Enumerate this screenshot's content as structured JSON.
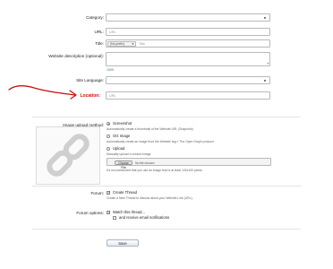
{
  "form": {
    "category": {
      "label": "Category:",
      "value": ""
    },
    "url": {
      "label": "URL:",
      "placeholder": "URL"
    },
    "title": {
      "label": "Title:",
      "prefix_select": "(No prefix)",
      "placeholder": "Title"
    },
    "description": {
      "label": "Website description (optional):",
      "counter": "1000"
    },
    "site_language": {
      "label": "Site Language:",
      "value": ""
    },
    "location": {
      "label": "Location:",
      "placeholder": "URL"
    }
  },
  "image_upload": {
    "label": "Image upload method:",
    "options": [
      {
        "label": "Screenshot",
        "help": "Automatically create a thumbnail of the Website URL (Snapshot)",
        "selected": true
      },
      {
        "label": "OG Image",
        "help": "Automatically create an image from the Website tag » The Open Graph protocol",
        "selected": false
      },
      {
        "label": "Upload",
        "help": "Manually upload a custom image",
        "selected": false
      }
    ],
    "choose_file": "Choose File",
    "no_file": "No file chosen",
    "recommendation": "It's recommended that you use an image that is at least 100x100 pixels."
  },
  "forum": {
    "label": "Forum:",
    "create_thread": "Create Thread",
    "create_thread_help": "Create a New Thread to discuss about your Website Link (URL)."
  },
  "forum_options": {
    "label": "Forum options:",
    "watch_thread": "Watch this thread...",
    "email_notifications": "and receive email notifications"
  },
  "save_button": "Save",
  "colors": {
    "annotation_red": "#cc1111",
    "accent_blue": "#2a4d8f"
  }
}
